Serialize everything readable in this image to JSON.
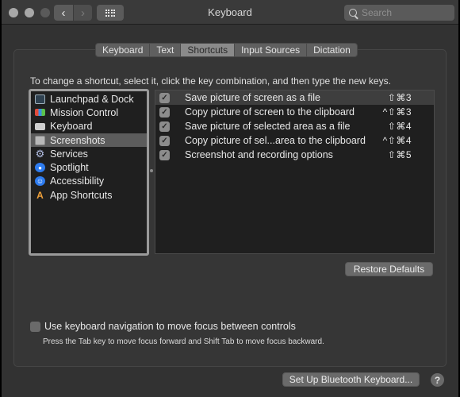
{
  "window": {
    "title": "Keyboard",
    "search_placeholder": "Search",
    "search_value": ""
  },
  "toolbar": {
    "back_icon": "‹",
    "forward_icon": "›"
  },
  "tabs": [
    {
      "label": "Keyboard",
      "active": false
    },
    {
      "label": "Text",
      "active": false
    },
    {
      "label": "Shortcuts",
      "active": true
    },
    {
      "label": "Input Sources",
      "active": false
    },
    {
      "label": "Dictation",
      "active": false
    }
  ],
  "instruction": "To change a shortcut, select it, click the key combination, and then type the new keys.",
  "categories": [
    {
      "label": "Launchpad & Dock",
      "icon": "launchpad-icon",
      "selected": false
    },
    {
      "label": "Mission Control",
      "icon": "mission-control-icon",
      "selected": false
    },
    {
      "label": "Keyboard",
      "icon": "keyboard-icon",
      "selected": false
    },
    {
      "label": "Screenshots",
      "icon": "screenshots-icon",
      "selected": true
    },
    {
      "label": "Services",
      "icon": "gear-icon",
      "selected": false
    },
    {
      "label": "Spotlight",
      "icon": "spotlight-icon",
      "selected": false
    },
    {
      "label": "Accessibility",
      "icon": "accessibility-icon",
      "selected": false
    },
    {
      "label": "App Shortcuts",
      "icon": "app-shortcuts-icon",
      "selected": false
    }
  ],
  "shortcuts": [
    {
      "label": "Save picture of screen as a file",
      "keys": "⇧⌘3",
      "checked": true,
      "selected": true
    },
    {
      "label": "Copy picture of screen to the clipboard",
      "keys": "^⇧⌘3",
      "checked": true,
      "selected": false
    },
    {
      "label": "Save picture of selected area as a file",
      "keys": "⇧⌘4",
      "checked": true,
      "selected": false
    },
    {
      "label": "Copy picture of sel...area to the clipboard",
      "keys": "^⇧⌘4",
      "checked": true,
      "selected": false
    },
    {
      "label": "Screenshot and recording options",
      "keys": "⇧⌘5",
      "checked": true,
      "selected": false
    }
  ],
  "buttons": {
    "restore_defaults": "Restore Defaults",
    "setup_bluetooth": "Set Up Bluetooth Keyboard...",
    "help": "?"
  },
  "keyboard_navigation": {
    "label": "Use keyboard navigation to move focus between controls",
    "checked": false,
    "hint": "Press the Tab key to move focus forward and Shift Tab to move focus backward."
  }
}
